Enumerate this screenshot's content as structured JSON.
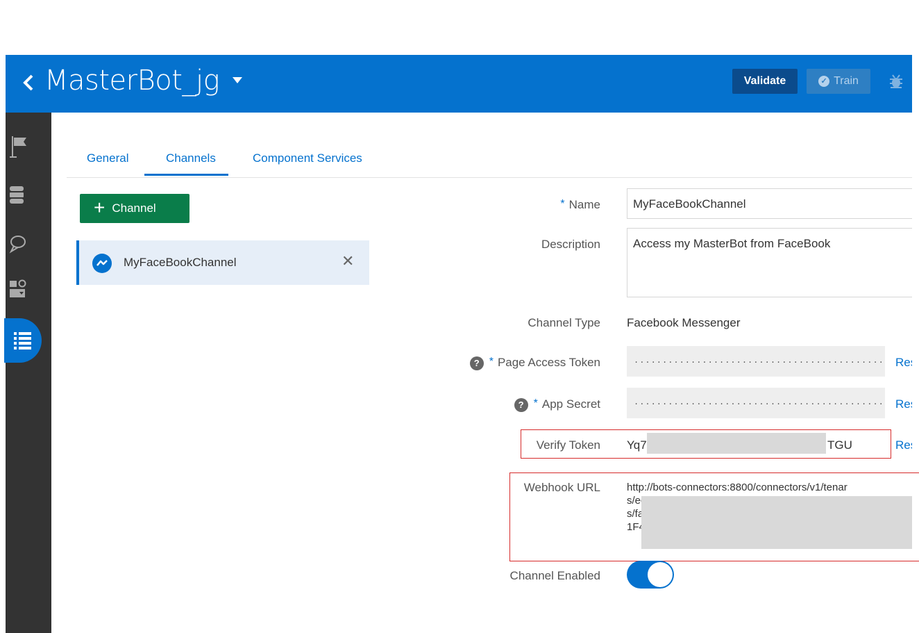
{
  "header": {
    "bot_name": "MasterBot_jg",
    "validate_label": "Validate",
    "train_label": "Train"
  },
  "sidebar": {
    "items": [
      {
        "icon": "flag-icon"
      },
      {
        "icon": "database-icon"
      },
      {
        "icon": "chat-icon"
      },
      {
        "icon": "components-icon"
      },
      {
        "icon": "list-icon",
        "active": true
      }
    ]
  },
  "tabs": [
    {
      "label": "General"
    },
    {
      "label": "Channels",
      "active": true
    },
    {
      "label": "Component Services"
    }
  ],
  "channels": {
    "add_label": "Channel",
    "list": [
      {
        "name": "MyFaceBookChannel"
      }
    ]
  },
  "form": {
    "name_label": "Name",
    "name_value": "MyFaceBookChannel",
    "description_label": "Description",
    "description_value": "Access my MasterBot from FaceBook",
    "channel_type_label": "Channel Type",
    "channel_type_value": "Facebook Messenger",
    "page_access_token_label": "Page Access Token",
    "page_access_token_value": "................................................",
    "app_secret_label": "App Secret",
    "app_secret_value": "................................................",
    "verify_token_label": "Verify Token",
    "verify_token_start": "Yq7",
    "verify_token_end": "TGU",
    "webhook_label": "Webhook URL",
    "webhook_line1": "http://bots-connectors:8800/connectors/v1/tenar",
    "webhook_line2": "s/ec",
    "webhook_line3": "s/fa",
    "webhook_line4": "1F4",
    "channel_enabled_label": "Channel Enabled",
    "channel_enabled": true,
    "reset_label": "Res",
    "required_mark": "*",
    "help_mark": "?"
  },
  "colors": {
    "brand_blue": "#0572ce",
    "add_green": "#0a7d4a",
    "sidebar_bg": "#333333",
    "highlight_red": "#d62b2b"
  }
}
